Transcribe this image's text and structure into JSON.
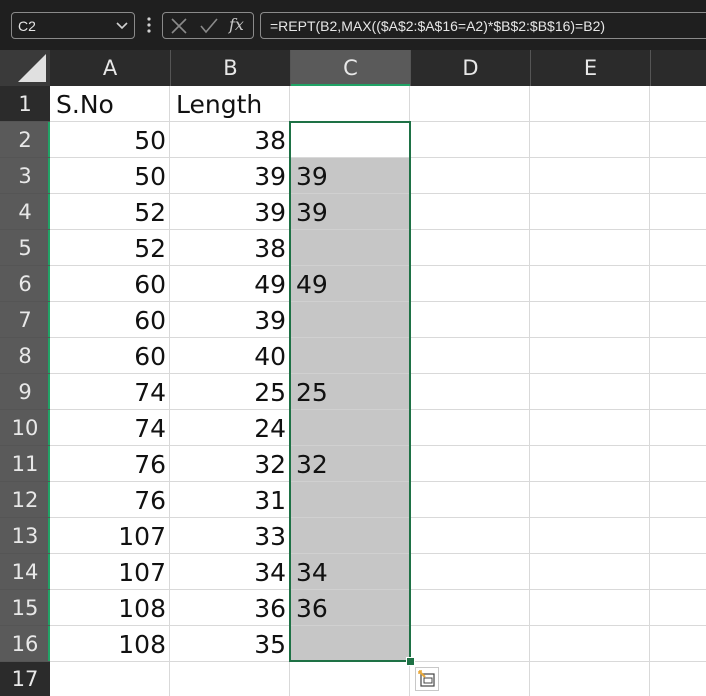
{
  "name_box": {
    "value": "C2"
  },
  "formula_bar": {
    "fx_label": "fx",
    "formula": "=REPT(B2,MAX(($A$2:$A$16=A2)*$B$2:$B$16)=B2)"
  },
  "columns": [
    "A",
    "B",
    "C",
    "D",
    "E"
  ],
  "rows": [
    "1",
    "2",
    "3",
    "4",
    "5",
    "6",
    "7",
    "8",
    "9",
    "10",
    "11",
    "12",
    "13",
    "14",
    "15",
    "16",
    "17"
  ],
  "sheet": {
    "headers": {
      "A": "S.No",
      "B": "Length",
      "C": ""
    },
    "data": [
      {
        "A": "50",
        "B": "38",
        "C": ""
      },
      {
        "A": "50",
        "B": "39",
        "C": "39"
      },
      {
        "A": "52",
        "B": "39",
        "C": "39"
      },
      {
        "A": "52",
        "B": "38",
        "C": ""
      },
      {
        "A": "60",
        "B": "49",
        "C": "49"
      },
      {
        "A": "60",
        "B": "39",
        "C": ""
      },
      {
        "A": "60",
        "B": "40",
        "C": ""
      },
      {
        "A": "74",
        "B": "25",
        "C": "25"
      },
      {
        "A": "74",
        "B": "24",
        "C": ""
      },
      {
        "A": "76",
        "B": "32",
        "C": "32"
      },
      {
        "A": "76",
        "B": "31",
        "C": ""
      },
      {
        "A": "107",
        "B": "33",
        "C": ""
      },
      {
        "A": "107",
        "B": "34",
        "C": "34"
      },
      {
        "A": "108",
        "B": "36",
        "C": "36"
      },
      {
        "A": "108",
        "B": "35",
        "C": ""
      }
    ]
  },
  "selection": {
    "range": "C2:C16",
    "active_cell": "C2"
  },
  "colors": {
    "selection_border": "#1e7145",
    "selection_fill": "#c6c6c6",
    "header_bg": "#2b2b2b",
    "header_selected_bg": "#5a5a5a"
  },
  "icons": {
    "name_box_dropdown": "chevron-down-icon",
    "more": "vertical-dots-icon",
    "cancel": "close-icon",
    "enter": "check-icon",
    "function": "fx-icon",
    "quick_analysis": "quick-analysis-icon"
  }
}
